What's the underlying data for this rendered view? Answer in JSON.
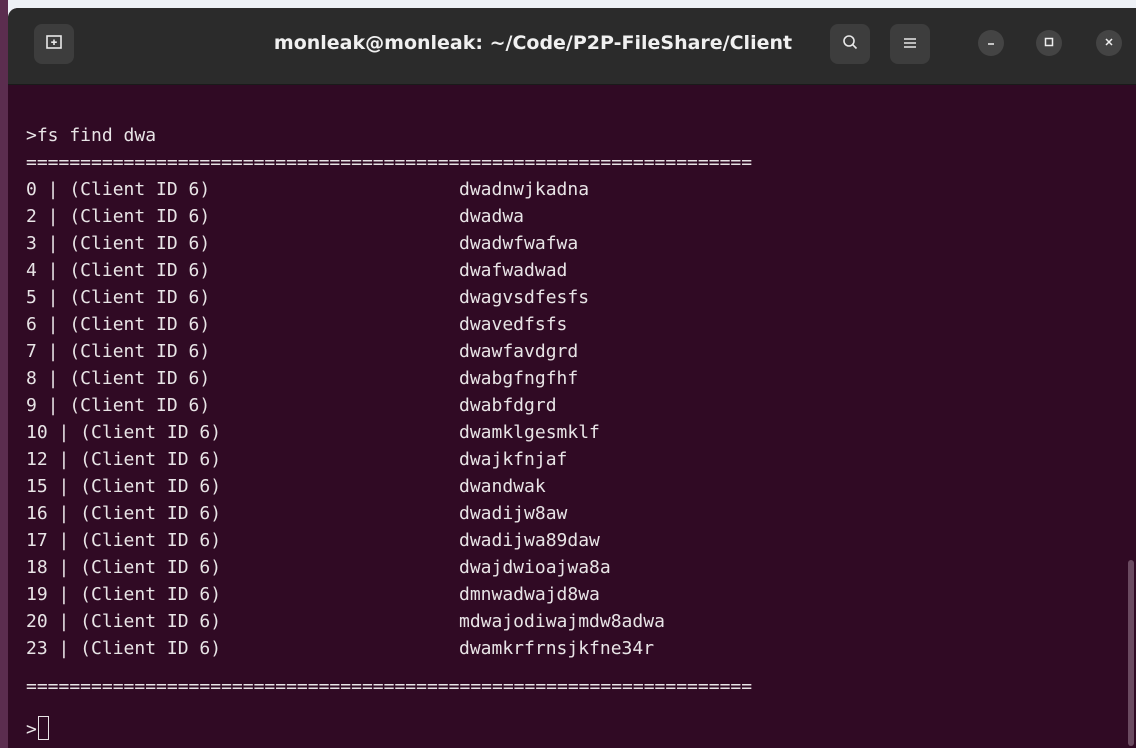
{
  "window": {
    "title": "monleak@monleak: ~/Code/P2P-FileShare/Client",
    "new_tab_icon": "new-tab-icon",
    "search_icon": "search-icon",
    "menu_icon": "hamburger-menu-icon",
    "minimize_icon": "minimize-icon",
    "maximize_icon": "maximize-icon",
    "close_icon": "close-icon"
  },
  "terminal": {
    "command_line": ">fs find dwa",
    "separator": "===================================================================",
    "rows": [
      {
        "id_col": "0 | (Client ID 6)",
        "name": "dwadnwjkadna"
      },
      {
        "id_col": "2 | (Client ID 6)",
        "name": "dwadwa"
      },
      {
        "id_col": "3 | (Client ID 6)",
        "name": "dwadwfwafwa"
      },
      {
        "id_col": "4 | (Client ID 6)",
        "name": "dwafwadwad"
      },
      {
        "id_col": "5 | (Client ID 6)",
        "name": "dwagvsdfesfs"
      },
      {
        "id_col": "6 | (Client ID 6)",
        "name": "dwavedfsfs"
      },
      {
        "id_col": "7 | (Client ID 6)",
        "name": "dwawfavdgrd"
      },
      {
        "id_col": "8 | (Client ID 6)",
        "name": "dwabgfngfhf"
      },
      {
        "id_col": "9 | (Client ID 6)",
        "name": "dwabfdgrd"
      },
      {
        "id_col": "10 | (Client ID 6)",
        "name": "dwamklgesmklf"
      },
      {
        "id_col": "12 | (Client ID 6)",
        "name": "dwajkfnjaf"
      },
      {
        "id_col": "15 | (Client ID 6)",
        "name": "dwandwak"
      },
      {
        "id_col": "16 | (Client ID 6)",
        "name": "dwadijw8aw"
      },
      {
        "id_col": "17 | (Client ID 6)",
        "name": "dwadijwa89daw"
      },
      {
        "id_col": "18 | (Client ID 6)",
        "name": "dwajdwioajwa8a"
      },
      {
        "id_col": "19 | (Client ID 6)",
        "name": "dmnwadwajd8wa"
      },
      {
        "id_col": "20 | (Client ID 6)",
        "name": "mdwajodiwajmdw8adwa"
      },
      {
        "id_col": "23 | (Client ID 6)",
        "name": "dwamkrfrnsjkfne34r"
      }
    ],
    "prompt": ">"
  },
  "colors": {
    "terminal_bg": "#300a24",
    "titlebar_bg": "#2b2b2b",
    "text": "#e8e4e6"
  }
}
